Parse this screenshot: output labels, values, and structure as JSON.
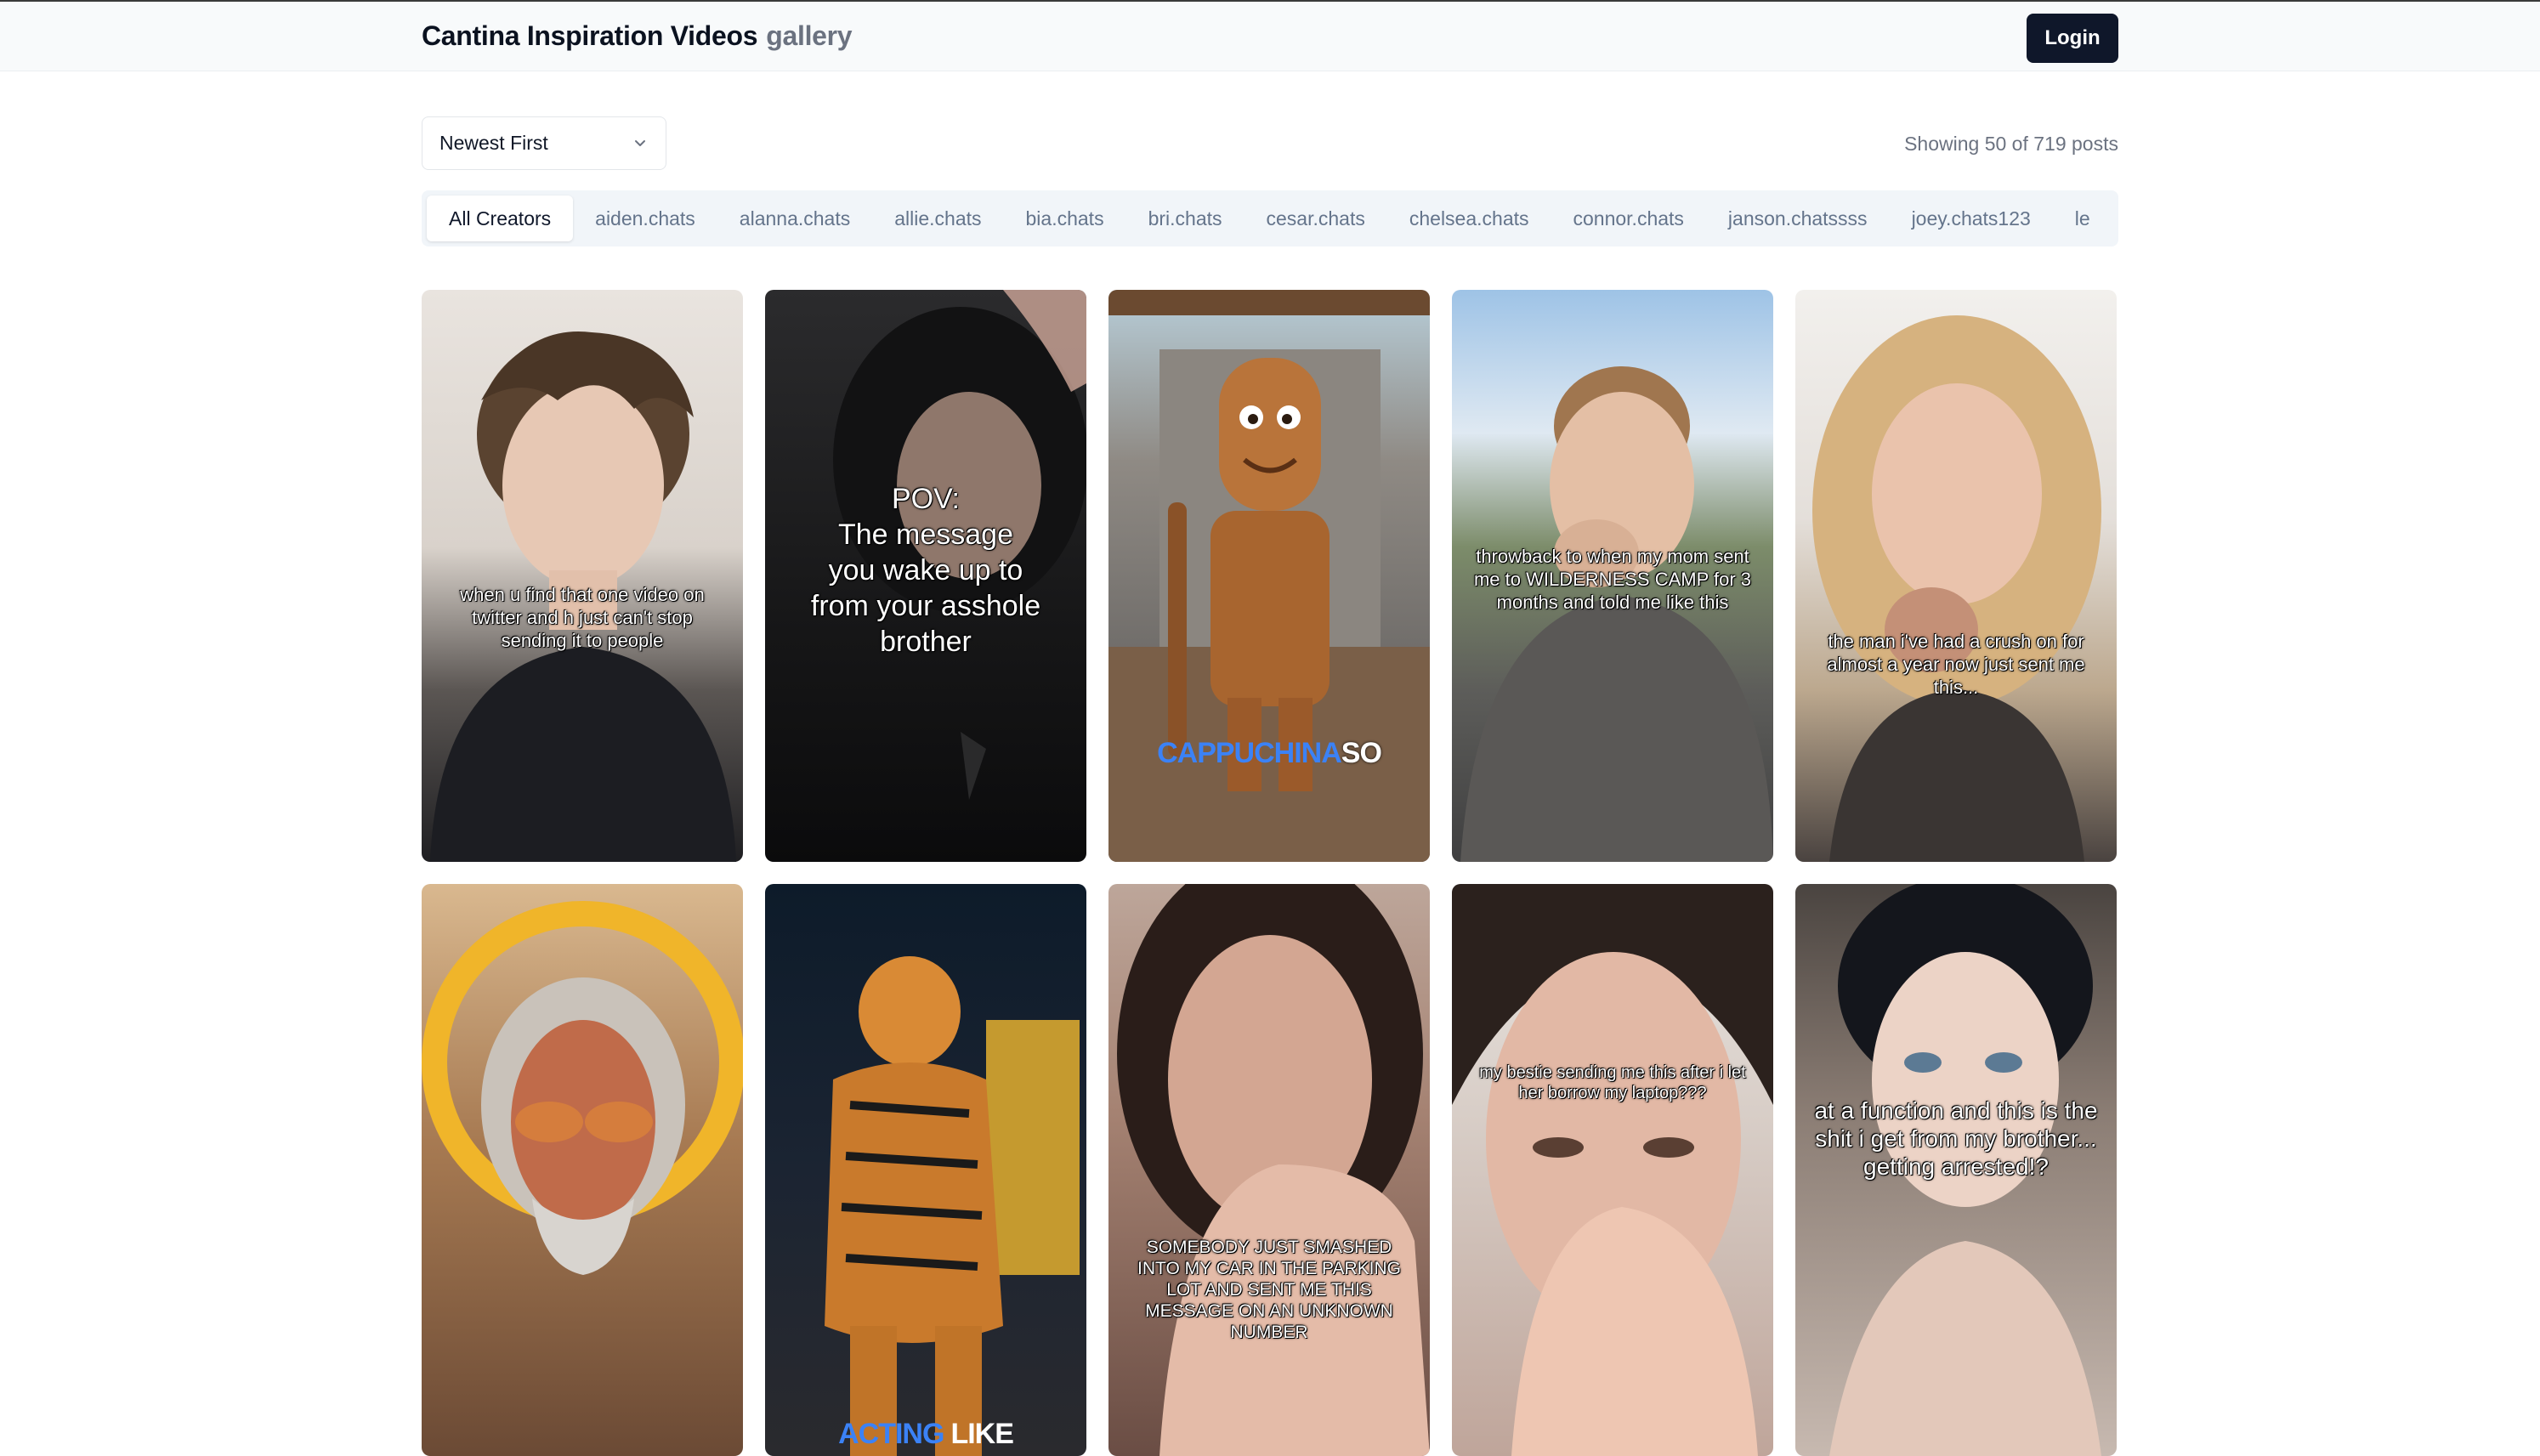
{
  "header": {
    "title": "Cantina Inspiration Videos",
    "subtitle": "gallery",
    "login_label": "Login"
  },
  "controls": {
    "sort_value": "Newest First",
    "showing_text": "Showing 50 of 719 posts"
  },
  "creators": [
    "All Creators",
    "aiden.chats",
    "alanna.chats",
    "allie.chats",
    "bia.chats",
    "bri.chats",
    "cesar.chats",
    "chelsea.chats",
    "connor.chats",
    "janson.chatssss",
    "joey.chats123",
    "le"
  ],
  "active_creator": "All Creators",
  "videos": [
    {
      "caption": "when u find that one video on twitter and h just can't stop sending it to people"
    },
    {
      "caption": "POV:\nThe message\nyou wake up to\nfrom your asshole\nbrother"
    },
    {
      "caption": "",
      "overlay_a": "CAPPUCHINA",
      "overlay_b": "SO"
    },
    {
      "caption": "throwback to when my mom sent me to WILDERNESS CAMP for 3 months and told me like this"
    },
    {
      "caption": "the man i've had a crush on for almost a year now just sent me this..."
    },
    {
      "caption": ""
    },
    {
      "caption": "",
      "overlay_a": "ACTING",
      "overlay_b": "LIKE"
    },
    {
      "caption": "SOMEBODY JUST SMASHED INTO MY CAR IN THE PARKING LOT AND SENT ME THIS MESSAGE ON AN UNKNOWN NUMBER"
    },
    {
      "caption": "my bestie sending me this after i let her borrow my laptop???"
    },
    {
      "caption": "at a function and this is the shit i get from my brother... getting arrested!?"
    }
  ],
  "colors": {
    "accent_dark": "#0f172a",
    "muted_text": "#6b7280",
    "tab_bg": "#f1f5f9",
    "overlay_blue": "#3b82f6"
  }
}
